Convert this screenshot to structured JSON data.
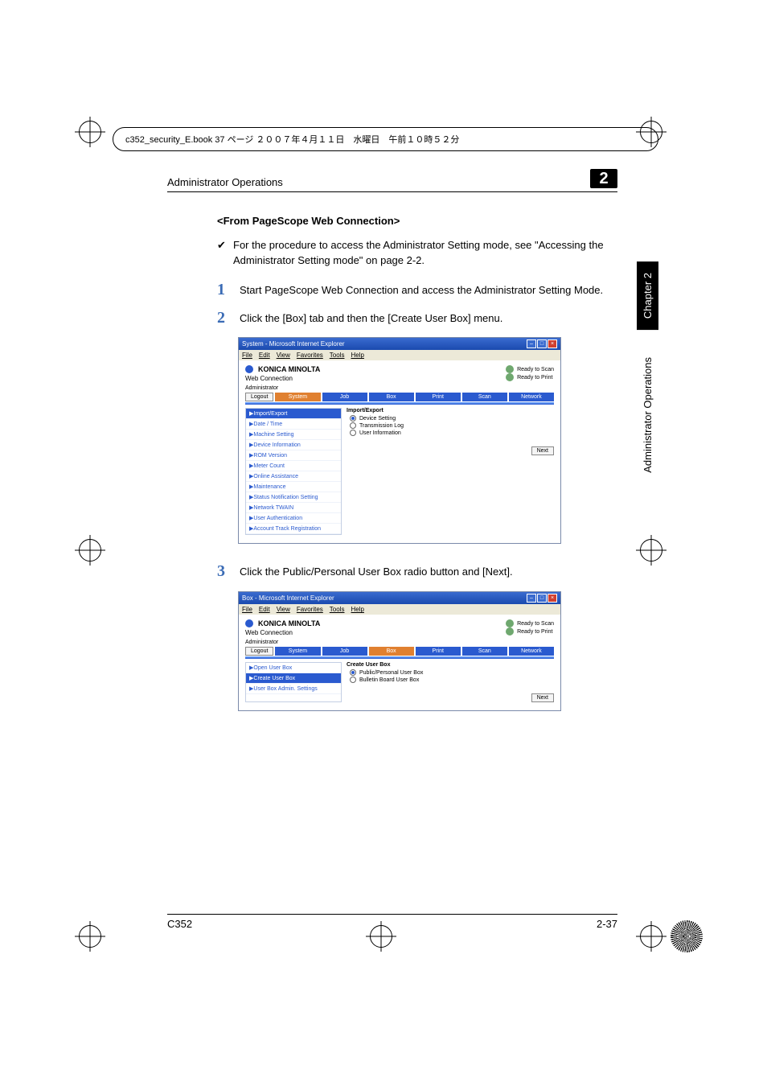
{
  "header_strip": "c352_security_E.book  37 ページ  ２００７年４月１１日　水曜日　午前１０時５２分",
  "section": {
    "title_left": "Administrator Operations",
    "chapter_num": "2"
  },
  "subheading": "<From PageScope Web Connection>",
  "checklist": [
    "For the procedure to access the Administrator Setting mode, see \"Accessing the Administrator Setting mode\" on page 2-2."
  ],
  "steps": [
    {
      "num": "1",
      "text": "Start PageScope Web Connection and access the Administrator Setting Mode."
    },
    {
      "num": "2",
      "text": "Click the [Box] tab and then the [Create User Box] menu."
    },
    {
      "num": "3",
      "text": "Click the Public/Personal User Box radio button and [Next]."
    }
  ],
  "screenshot1": {
    "title": "System - Microsoft Internet Explorer",
    "menus": [
      "File",
      "Edit",
      "View",
      "Favorites",
      "Tools",
      "Help"
    ],
    "brand": "KONICA MINOLTA",
    "connection": "Web Connection",
    "status": [
      "Ready to Scan",
      "Ready to Print"
    ],
    "admin": "Administrator",
    "logout": "Logout",
    "tabs": [
      "System",
      "Job",
      "Box",
      "Print",
      "Scan",
      "Network"
    ],
    "left_nav": [
      "▶Import/Export",
      "▶Date / Time",
      "▶Machine Setting",
      "▶Device Information",
      "▶ROM Version",
      "▶Meter Count",
      "▶Online Assistance",
      "▶Maintenance",
      "▶Status Notification Setting",
      "▶Network TWAIN",
      "▶User Authentication",
      "▶Account Track Registration"
    ],
    "panel_title": "Import/Export",
    "radios": [
      "Device Setting",
      "Transmission Log",
      "User Information"
    ],
    "next": "Next"
  },
  "screenshot2": {
    "title": "Box - Microsoft Internet Explorer",
    "menus": [
      "File",
      "Edit",
      "View",
      "Favorites",
      "Tools",
      "Help"
    ],
    "brand": "KONICA MINOLTA",
    "connection": "Web Connection",
    "status": [
      "Ready to Scan",
      "Ready to Print"
    ],
    "admin": "Administrator",
    "logout": "Logout",
    "tabs": [
      "System",
      "Job",
      "Box",
      "Print",
      "Scan",
      "Network"
    ],
    "left_nav": [
      "▶Open User Box",
      "▶Create User Box",
      "▶User Box Admin. Settings"
    ],
    "panel_title": "Create User Box",
    "radios": [
      "Public/Personal User Box",
      "Bulletin Board User Box"
    ],
    "next": "Next"
  },
  "side_tabs": {
    "chapter": "Chapter 2",
    "title": "Administrator Operations"
  },
  "footer": {
    "left": "C352",
    "right": "2-37"
  }
}
